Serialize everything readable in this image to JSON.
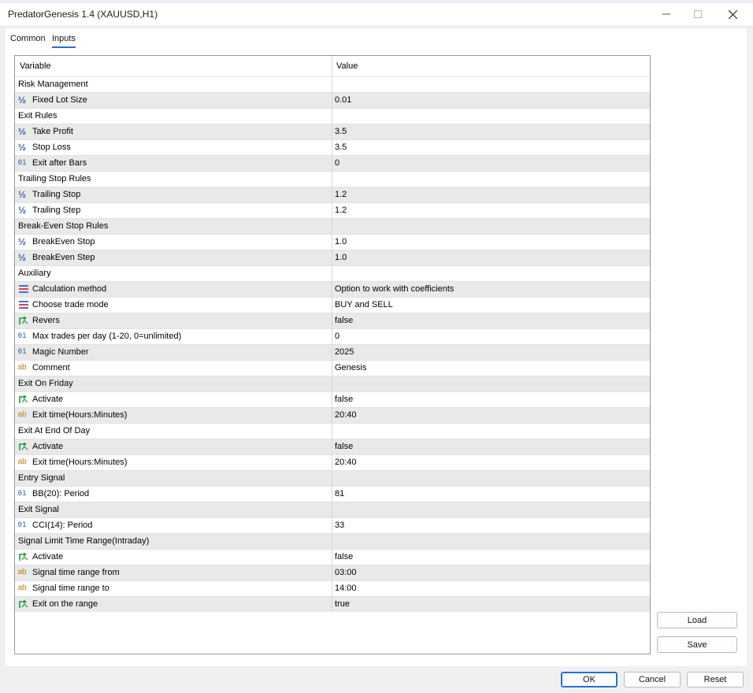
{
  "window": {
    "title": "PredatorGenesis 1.4 (XAUUSD,H1)"
  },
  "tabs": [
    {
      "label": "Common"
    },
    {
      "label": "Inputs"
    }
  ],
  "grid": {
    "header": {
      "variable": "Variable",
      "value": "Value"
    },
    "rows": [
      {
        "name": "Risk Management",
        "value": "",
        "icon": ""
      },
      {
        "name": "Fixed Lot Size",
        "value": "0.01",
        "icon": "double-icon"
      },
      {
        "name": "Exit Rules",
        "value": "",
        "icon": ""
      },
      {
        "name": "Take Profit",
        "value": "3.5",
        "icon": "double-icon"
      },
      {
        "name": "Stop Loss",
        "value": "3.5",
        "icon": "double-icon"
      },
      {
        "name": "Exit after Bars",
        "value": "0",
        "icon": "integer-icon"
      },
      {
        "name": "Trailing Stop Rules",
        "value": "",
        "icon": ""
      },
      {
        "name": "Trailing Stop",
        "value": "1.2",
        "icon": "double-icon"
      },
      {
        "name": "Trailing Step",
        "value": "1.2",
        "icon": "double-icon"
      },
      {
        "name": "Break-Even Stop Rules",
        "value": "",
        "icon": ""
      },
      {
        "name": "BreakEven Stop",
        "value": "1.0",
        "icon": "double-icon"
      },
      {
        "name": "BreakEven Step",
        "value": "1.0",
        "icon": "double-icon"
      },
      {
        "name": "Auxiliary",
        "value": "",
        "icon": ""
      },
      {
        "name": "Calculation method",
        "value": "Option to work with coefficients",
        "icon": "enum-icon"
      },
      {
        "name": "Choose trade mode",
        "value": "BUY and SELL",
        "icon": "enum-icon"
      },
      {
        "name": "Revers",
        "value": "false",
        "icon": "bool-icon"
      },
      {
        "name": "Max trades per day (1-20, 0=unlimited)",
        "value": "0",
        "icon": "integer-icon"
      },
      {
        "name": "Magic Number",
        "value": "2025",
        "icon": "integer-icon"
      },
      {
        "name": "Comment",
        "value": "Genesis",
        "icon": "string-icon"
      },
      {
        "name": "Exit On Friday",
        "value": "",
        "icon": ""
      },
      {
        "name": "Activate",
        "value": "false",
        "icon": "bool-icon"
      },
      {
        "name": "Exit time(Hours:Minutes)",
        "value": "20:40",
        "icon": "string-icon"
      },
      {
        "name": "Exit At End Of Day",
        "value": "",
        "icon": ""
      },
      {
        "name": "Activate",
        "value": "false",
        "icon": "bool-icon"
      },
      {
        "name": "Exit time(Hours:Minutes)",
        "value": "20:40",
        "icon": "string-icon"
      },
      {
        "name": "Entry Signal",
        "value": "",
        "icon": ""
      },
      {
        "name": "BB(20):   Period",
        "value": "81",
        "icon": "integer-icon"
      },
      {
        "name": "Exit Signal",
        "value": "",
        "icon": ""
      },
      {
        "name": "CCI(14):  Period",
        "value": "33",
        "icon": "integer-icon"
      },
      {
        "name": "Signal Limit Time Range(Intraday)",
        "value": "",
        "icon": ""
      },
      {
        "name": "Activate",
        "value": "false",
        "icon": "bool-icon"
      },
      {
        "name": "Signal time range from",
        "value": "03:00",
        "icon": "string-icon"
      },
      {
        "name": "Signal time range to",
        "value": "14:00",
        "icon": "string-icon"
      },
      {
        "name": "Exit on the range",
        "value": "true",
        "icon": "bool-icon"
      }
    ]
  },
  "side_buttons": {
    "load": "Load",
    "save": "Save"
  },
  "buttons": {
    "ok": "OK",
    "cancel": "Cancel",
    "reset": "Reset"
  }
}
